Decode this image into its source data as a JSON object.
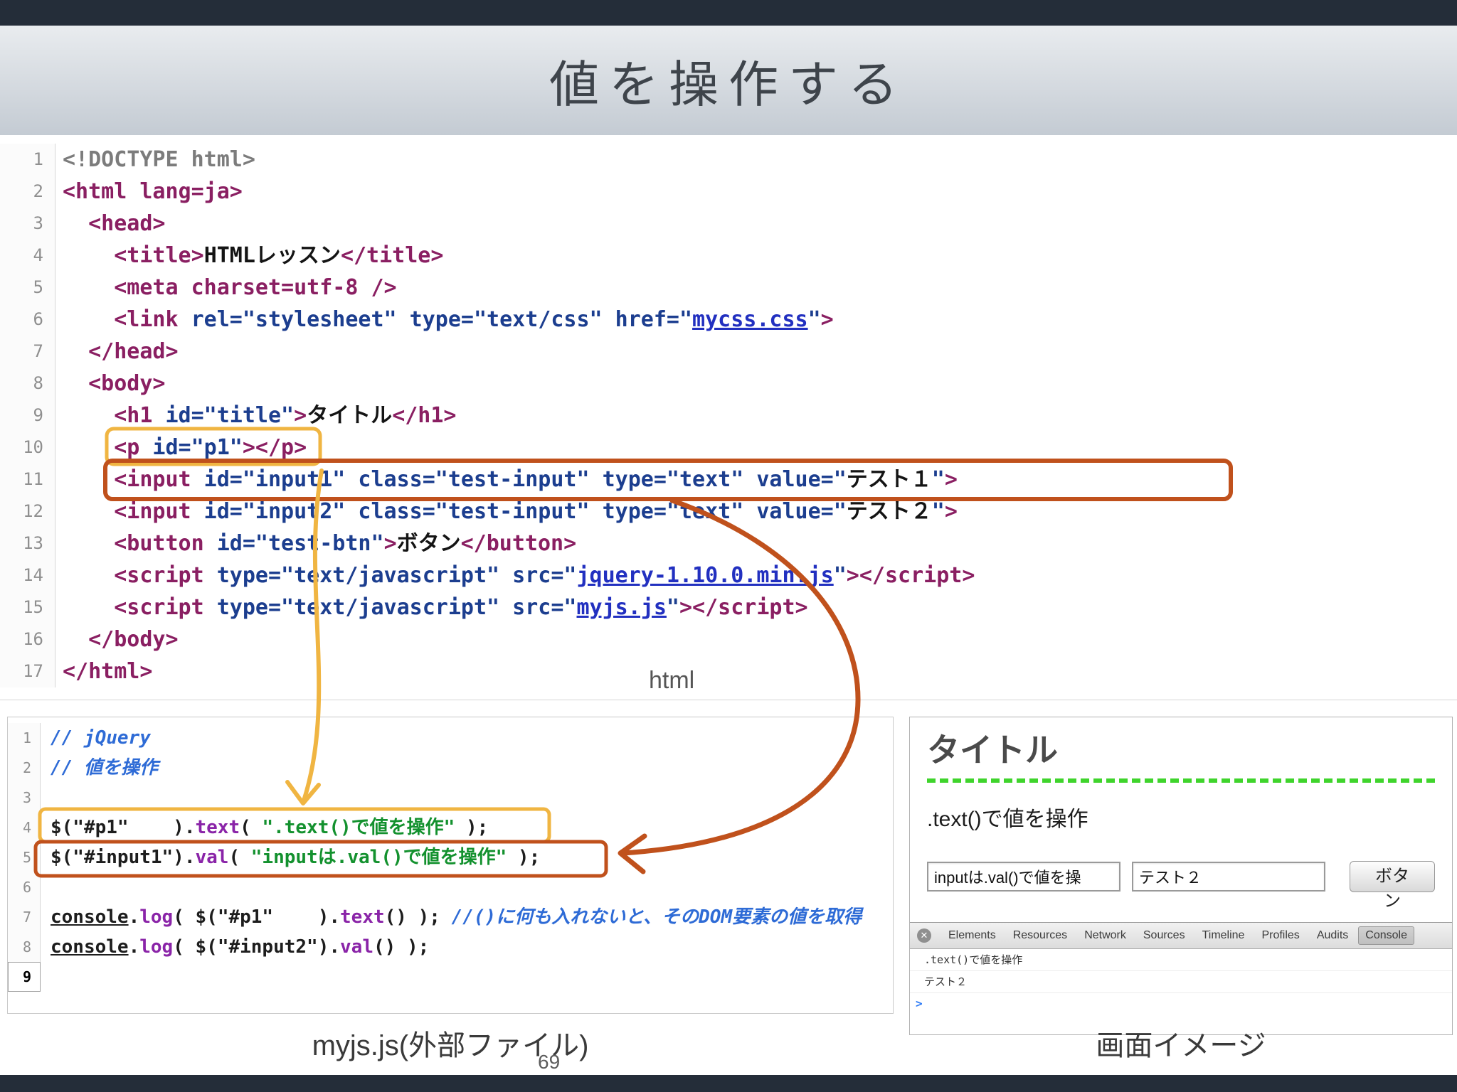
{
  "slide": {
    "title": "値を操作する",
    "page_number": "69",
    "labels": {
      "html_panel": "html",
      "js_panel": "myjs.js(外部ファイル)",
      "preview_panel": "画面イメージ"
    }
  },
  "colors": {
    "annotation_yellow": "#f0b542",
    "annotation_orange": "#c0511c",
    "preview_divider_green": "#3fd42c",
    "chrome_bar": "#242d39"
  },
  "icons": {
    "devtools_close": "✕"
  },
  "html_editor": {
    "lines": [
      {
        "num": 1,
        "segs": [
          [
            "doctype",
            "<!DOCTYPE html>"
          ]
        ]
      },
      {
        "num": 2,
        "segs": [
          [
            "tag",
            "<html lang=ja>"
          ]
        ]
      },
      {
        "num": 3,
        "segs": [
          [
            "plain",
            "  "
          ],
          [
            "tag",
            "<head>"
          ]
        ]
      },
      {
        "num": 4,
        "segs": [
          [
            "plain",
            "    "
          ],
          [
            "tag",
            "<title>"
          ],
          [
            "text",
            "HTMLレッスン"
          ],
          [
            "tag",
            "</title>"
          ]
        ]
      },
      {
        "num": 5,
        "segs": [
          [
            "plain",
            "    "
          ],
          [
            "tag",
            "<meta charset=utf-8 />"
          ]
        ]
      },
      {
        "num": 6,
        "segs": [
          [
            "plain",
            "    "
          ],
          [
            "tag",
            "<link"
          ],
          [
            "attr",
            " rel=\"stylesheet\" type=\"text/css\" href=\""
          ],
          [
            "link",
            "mycss.css"
          ],
          [
            "attr",
            "\""
          ],
          [
            "tag",
            ">"
          ]
        ]
      },
      {
        "num": 7,
        "segs": [
          [
            "plain",
            "  "
          ],
          [
            "tag",
            "</head>"
          ]
        ]
      },
      {
        "num": 8,
        "segs": [
          [
            "plain",
            "  "
          ],
          [
            "tag",
            "<body>"
          ]
        ]
      },
      {
        "num": 9,
        "segs": [
          [
            "plain",
            "    "
          ],
          [
            "tag",
            "<h1"
          ],
          [
            "attr",
            " id=\"title\""
          ],
          [
            "tag",
            ">"
          ],
          [
            "text",
            "タイトル"
          ],
          [
            "tag",
            "</h1>"
          ]
        ]
      },
      {
        "num": 10,
        "segs": [
          [
            "plain",
            "    "
          ],
          [
            "tag",
            "<p"
          ],
          [
            "attr",
            " id=\"p1\""
          ],
          [
            "tag",
            "></p>"
          ]
        ]
      },
      {
        "num": 11,
        "segs": [
          [
            "plain",
            "    "
          ],
          [
            "tag",
            "<input"
          ],
          [
            "attr",
            " id=\"input1\" class=\"test-input\" type=\"text\" value=\""
          ],
          [
            "text",
            "テスト１"
          ],
          [
            "attr",
            "\""
          ],
          [
            "tag",
            ">"
          ]
        ]
      },
      {
        "num": 12,
        "segs": [
          [
            "plain",
            "    "
          ],
          [
            "tag",
            "<input"
          ],
          [
            "attr",
            " id=\"input2\" class=\"test-input\" type=\"text\" value=\""
          ],
          [
            "text",
            "テスト２"
          ],
          [
            "attr",
            "\""
          ],
          [
            "tag",
            ">"
          ]
        ]
      },
      {
        "num": 13,
        "segs": [
          [
            "plain",
            "    "
          ],
          [
            "tag",
            "<button"
          ],
          [
            "attr",
            " id=\"test-btn\""
          ],
          [
            "tag",
            ">"
          ],
          [
            "text",
            "ボタン"
          ],
          [
            "tag",
            "</button>"
          ]
        ]
      },
      {
        "num": 14,
        "segs": [
          [
            "plain",
            "    "
          ],
          [
            "tag",
            "<script"
          ],
          [
            "attr",
            " type=\"text/javascript\" src=\""
          ],
          [
            "link",
            "jquery-1.10.0.min.js"
          ],
          [
            "attr",
            "\""
          ],
          [
            "tag",
            "></script>"
          ]
        ]
      },
      {
        "num": 15,
        "segs": [
          [
            "plain",
            "    "
          ],
          [
            "tag",
            "<script"
          ],
          [
            "attr",
            " type=\"text/javascript\" src=\""
          ],
          [
            "link",
            "myjs.js"
          ],
          [
            "attr",
            "\""
          ],
          [
            "tag",
            "></script>"
          ]
        ]
      },
      {
        "num": 16,
        "segs": [
          [
            "plain",
            "  "
          ],
          [
            "tag",
            "</body>"
          ]
        ]
      },
      {
        "num": 17,
        "segs": [
          [
            "tag",
            "</html>"
          ]
        ]
      }
    ]
  },
  "js_editor": {
    "active_line": 9,
    "lines": [
      {
        "num": 1,
        "segs": [
          [
            "comment",
            "// jQuery"
          ]
        ]
      },
      {
        "num": 2,
        "segs": [
          [
            "comment",
            "// 値を操作"
          ]
        ]
      },
      {
        "num": 3,
        "segs": []
      },
      {
        "num": 4,
        "segs": [
          [
            "plain",
            "$(\"#p1\"    )."
          ],
          [
            "method",
            "text"
          ],
          [
            "plain",
            "( "
          ],
          [
            "string",
            "\".text()で値を操作\""
          ],
          [
            "plain",
            " );"
          ]
        ]
      },
      {
        "num": 5,
        "segs": [
          [
            "plain",
            "$(\"#input1\")."
          ],
          [
            "method",
            "val"
          ],
          [
            "plain",
            "( "
          ],
          [
            "string",
            "\"inputは.val()で値を操作\""
          ],
          [
            "plain",
            " );"
          ]
        ]
      },
      {
        "num": 6,
        "segs": []
      },
      {
        "num": 7,
        "segs": [
          [
            "console",
            "console"
          ],
          [
            "plain",
            "."
          ],
          [
            "method",
            "log"
          ],
          [
            "plain",
            "( $(\"#p1\"    )."
          ],
          [
            "method",
            "text"
          ],
          [
            "plain",
            "() ); "
          ],
          [
            "comment",
            "//()に何も入れないと、そのDOM要素の値を取得"
          ]
        ]
      },
      {
        "num": 8,
        "segs": [
          [
            "console",
            "console"
          ],
          [
            "plain",
            "."
          ],
          [
            "method",
            "log"
          ],
          [
            "plain",
            "( $(\"#input2\")."
          ],
          [
            "method",
            "val"
          ],
          [
            "plain",
            "() );"
          ]
        ]
      },
      {
        "num": 9,
        "segs": []
      }
    ]
  },
  "preview": {
    "heading": "タイトル",
    "paragraph_text": ".text()で値を操作",
    "input1_value": "inputは.val()で値を操",
    "input2_value": "テスト２",
    "button_label": "ボタン",
    "devtools": {
      "tabs": [
        "Elements",
        "Resources",
        "Network",
        "Sources",
        "Timeline",
        "Profiles",
        "Audits",
        "Console"
      ],
      "active_tab": "Console",
      "console_lines": [
        ".text()で値を操作",
        "テスト２"
      ],
      "prompt": ">"
    }
  }
}
